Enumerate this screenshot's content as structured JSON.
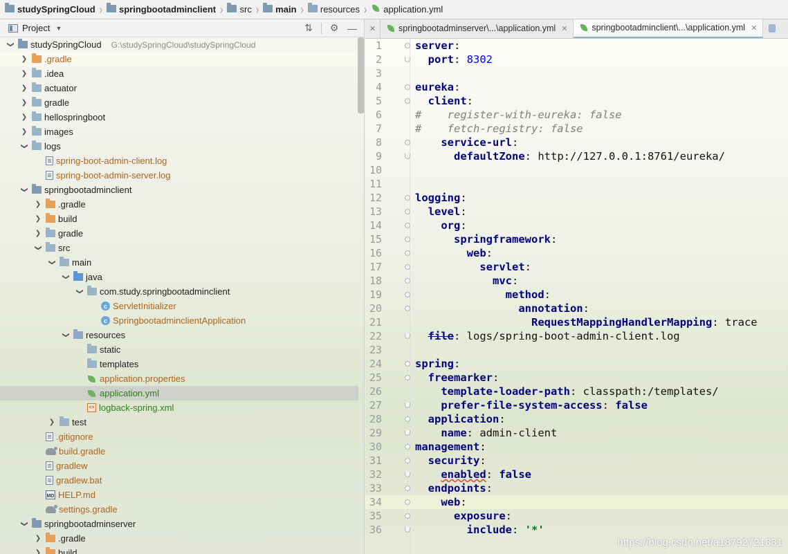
{
  "breadcrumb": [
    {
      "label": "studySpringCloud",
      "icon": "folder-icon",
      "bold": true
    },
    {
      "label": "springbootadminclient",
      "icon": "folder-icon",
      "bold": true
    },
    {
      "label": "src",
      "icon": "folder-icon",
      "bold": false
    },
    {
      "label": "main",
      "icon": "folder-icon",
      "bold": true
    },
    {
      "label": "resources",
      "icon": "resources-folder-icon",
      "bold": false
    },
    {
      "label": "application.yml",
      "icon": "spring-leaf-icon",
      "bold": false
    }
  ],
  "project_panel": {
    "title": "Project",
    "root_path": "G:\\studySpringCloud\\studySpringCloud",
    "tree": [
      {
        "label": "studySpringCloud",
        "depth": 0,
        "arrow": "down",
        "icon": "module-folder"
      },
      {
        "label": ".gradle",
        "depth": 1,
        "arrow": "right",
        "icon": "orange-folder",
        "color": "orange"
      },
      {
        "label": ".idea",
        "depth": 1,
        "arrow": "right",
        "icon": "folder"
      },
      {
        "label": "actuator",
        "depth": 1,
        "arrow": "right",
        "icon": "folder"
      },
      {
        "label": "gradle",
        "depth": 1,
        "arrow": "right",
        "icon": "folder"
      },
      {
        "label": "hellospringboot",
        "depth": 1,
        "arrow": "right",
        "icon": "folder"
      },
      {
        "label": "images",
        "depth": 1,
        "arrow": "right",
        "icon": "folder"
      },
      {
        "label": "logs",
        "depth": 1,
        "arrow": "down",
        "icon": "folder"
      },
      {
        "label": "spring-boot-admin-client.log",
        "depth": 2,
        "arrow": "none",
        "icon": "file",
        "color": "orange"
      },
      {
        "label": "spring-boot-admin-server.log",
        "depth": 2,
        "arrow": "none",
        "icon": "file",
        "color": "orange"
      },
      {
        "label": "springbootadminclient",
        "depth": 1,
        "arrow": "down",
        "icon": "module-folder"
      },
      {
        "label": ".gradle",
        "depth": 2,
        "arrow": "right",
        "icon": "orange-folder"
      },
      {
        "label": "build",
        "depth": 2,
        "arrow": "right",
        "icon": "orange-folder"
      },
      {
        "label": "gradle",
        "depth": 2,
        "arrow": "right",
        "icon": "folder"
      },
      {
        "label": "src",
        "depth": 2,
        "arrow": "down",
        "icon": "folder"
      },
      {
        "label": "main",
        "depth": 3,
        "arrow": "down",
        "icon": "folder"
      },
      {
        "label": "java",
        "depth": 4,
        "arrow": "down",
        "icon": "blue-folder"
      },
      {
        "label": "com.study.springbootadminclient",
        "depth": 5,
        "arrow": "down",
        "icon": "package-folder"
      },
      {
        "label": "ServletInitializer",
        "depth": 6,
        "arrow": "none",
        "icon": "class",
        "color": "orange"
      },
      {
        "label": "SpringbootadminclientApplication",
        "depth": 6,
        "arrow": "none",
        "icon": "class",
        "color": "orange"
      },
      {
        "label": "resources",
        "depth": 4,
        "arrow": "down",
        "icon": "resources-folder"
      },
      {
        "label": "static",
        "depth": 5,
        "arrow": "none",
        "icon": "folder"
      },
      {
        "label": "templates",
        "depth": 5,
        "arrow": "none",
        "icon": "folder"
      },
      {
        "label": "application.properties",
        "depth": 5,
        "arrow": "none",
        "icon": "spring-leaf",
        "color": "orange"
      },
      {
        "label": "application.yml",
        "depth": 5,
        "arrow": "none",
        "icon": "spring-leaf",
        "color": "green",
        "selected": true
      },
      {
        "label": "logback-spring.xml",
        "depth": 5,
        "arrow": "none",
        "icon": "xml",
        "color": "green"
      },
      {
        "label": "test",
        "depth": 3,
        "arrow": "right",
        "icon": "folder"
      },
      {
        "label": ".gitignore",
        "depth": 2,
        "arrow": "none",
        "icon": "file",
        "color": "orange"
      },
      {
        "label": "build.gradle",
        "depth": 2,
        "arrow": "none",
        "icon": "gradle",
        "color": "orange"
      },
      {
        "label": "gradlew",
        "depth": 2,
        "arrow": "none",
        "icon": "file",
        "color": "orange"
      },
      {
        "label": "gradlew.bat",
        "depth": 2,
        "arrow": "none",
        "icon": "file",
        "color": "orange"
      },
      {
        "label": "HELP.md",
        "depth": 2,
        "arrow": "none",
        "icon": "markdown",
        "color": "orange"
      },
      {
        "label": "settings.gradle",
        "depth": 2,
        "arrow": "none",
        "icon": "gradle",
        "color": "orange"
      },
      {
        "label": "springbootadminserver",
        "depth": 1,
        "arrow": "down",
        "icon": "module-folder"
      },
      {
        "label": ".gradle",
        "depth": 2,
        "arrow": "right",
        "icon": "orange-folder"
      },
      {
        "label": "build",
        "depth": 2,
        "arrow": "right",
        "icon": "orange-folder"
      }
    ]
  },
  "editor": {
    "tabs": [
      {
        "label": "springbootadminserver\\...\\application.yml",
        "active": false
      },
      {
        "label": "springbootadminclient\\...\\application.yml",
        "active": true
      }
    ],
    "lines": [
      {
        "n": "1",
        "text": "server:"
      },
      {
        "n": "2",
        "text": "  port: 8302"
      },
      {
        "n": "3",
        "text": ""
      },
      {
        "n": "4",
        "text": "eureka:"
      },
      {
        "n": "5",
        "text": "  client:"
      },
      {
        "n": "6",
        "text": "#    register-with-eureka: false"
      },
      {
        "n": "7",
        "text": "#    fetch-registry: false"
      },
      {
        "n": "8",
        "text": "    service-url:"
      },
      {
        "n": "9",
        "text": "      defaultZone: http://127.0.0.1:8761/eureka/"
      },
      {
        "n": "10",
        "text": ""
      },
      {
        "n": "11",
        "text": ""
      },
      {
        "n": "12",
        "text": "logging:"
      },
      {
        "n": "13",
        "text": "  level:"
      },
      {
        "n": "14",
        "text": "    org:"
      },
      {
        "n": "15",
        "text": "      springframework:"
      },
      {
        "n": "16",
        "text": "        web:"
      },
      {
        "n": "17",
        "text": "          servlet:"
      },
      {
        "n": "18",
        "text": "            mvc:"
      },
      {
        "n": "19",
        "text": "              method:"
      },
      {
        "n": "20",
        "text": "                annotation:"
      },
      {
        "n": "21",
        "text": "                  RequestMappingHandlerMapping: trace"
      },
      {
        "n": "22",
        "text": "  file: logs/spring-boot-admin-client.log"
      },
      {
        "n": "23",
        "text": ""
      },
      {
        "n": "24",
        "text": "spring:"
      },
      {
        "n": "25",
        "text": "  freemarker:"
      },
      {
        "n": "26",
        "text": "    template-loader-path: classpath:/templates/"
      },
      {
        "n": "27",
        "text": "    prefer-file-system-access: false"
      },
      {
        "n": "28",
        "text": "  application:"
      },
      {
        "n": "29",
        "text": "    name: admin-client"
      },
      {
        "n": "30",
        "text": "management:"
      },
      {
        "n": "31",
        "text": "  security:"
      },
      {
        "n": "32",
        "text": "    enabled: false"
      },
      {
        "n": "33",
        "text": "  endpoints:"
      },
      {
        "n": "34",
        "text": "    web:"
      },
      {
        "n": "35",
        "text": "      exposure:"
      },
      {
        "n": "36",
        "text": "        include: '*'"
      }
    ]
  },
  "watermark": "https://blog.csdn.net/a18792721831"
}
